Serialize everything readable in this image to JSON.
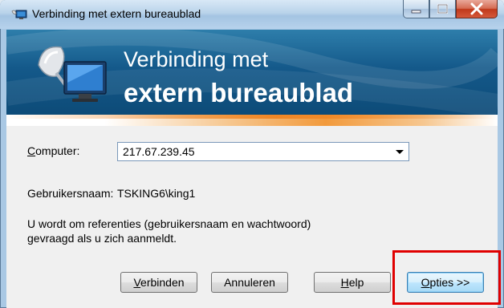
{
  "window": {
    "title": "Verbinding met extern bureaublad",
    "caption_buttons": [
      "minimize",
      "maximize",
      "close"
    ]
  },
  "banner": {
    "line1": "Verbinding met",
    "line2": "extern bureaublad",
    "icon": "remote-desktop-icon"
  },
  "form": {
    "computer_label_first": "C",
    "computer_label_rest": "omputer:",
    "computer_value": "217.67.239.45",
    "username_label": "Gebruikersnaam:",
    "username_value": "TSKING6\\king1",
    "info_line1": "U wordt om referenties (gebruikersnaam en wachtwoord)",
    "info_line2": "gevraagd als u zich aanmeldt."
  },
  "buttons": {
    "connect_first": "V",
    "connect_rest": "erbinden",
    "cancel": "Annuleren",
    "help_first": "H",
    "help_rest": "elp",
    "options_first": "O",
    "options_rest": "pties >>"
  },
  "colors": {
    "banner": "#14598a",
    "highlight_box": "#e00000",
    "accent_strip": "#f29a3c"
  }
}
